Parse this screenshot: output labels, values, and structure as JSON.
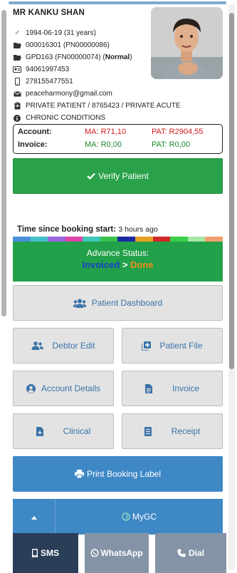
{
  "patient": {
    "name": "MR KANKU SHAN",
    "dob": "1994-06-19 (31 years)",
    "file_number": "000016301 (PN00000086)",
    "gpd_prefix": "GPD163 (FN00000074) (",
    "gpd_status": "Normal",
    "gpd_suffix": ")",
    "id_number": "94061997453",
    "phone": "278155477551",
    "email": "peaceharmony@gmail.com",
    "medical_aid": "PRIVATE PATIENT / 8765423 / PRIVATE ACUTE",
    "chronic": "CHRONIC CONDITIONS"
  },
  "finances": {
    "account_label": "Account:",
    "account_ma": "MA: R71,10",
    "account_pat": "PAT: R2904,55",
    "invoice_label": "Invoice:",
    "invoice_ma": "MA: R0,00",
    "invoice_pat": "PAT: R0,00"
  },
  "verify_label": "Verify Patient",
  "booking_time": {
    "label": "Time since booking start:",
    "value": "3 hours ago",
    "progress_colors": [
      "#4a8fd8",
      "#44c0c8",
      "#9966dd",
      "#dd44aa",
      "#3ec7b8",
      "#36c14a",
      "#1a2aa0",
      "#e6a020",
      "#d02a2a",
      "#3ad04a",
      "#a6e6a6",
      "#f0a070"
    ]
  },
  "advance_status": {
    "title": "Advance Status:",
    "from": "Invoiced",
    "arrow": ">",
    "to": "Done"
  },
  "buttons": {
    "dashboard": "Patient Dashboard",
    "debtor_edit": "Debtor Edit",
    "patient_file": "Patient File",
    "account_details": "Account Details",
    "invoice": "Invoice",
    "clinical": "Clinical",
    "receipt": "Receipt",
    "print_label": "Print Booking Label",
    "mygc": "MyGC"
  },
  "bottom": {
    "sms": "SMS",
    "whatsapp": "WhatsApp",
    "dial": "Dial"
  },
  "colors": {
    "green": "#2aa24a",
    "blue": "#3f88c6",
    "link_blue": "#3a73a8",
    "dark_nav": "#2a3e57",
    "grey_nav": "#8494a6"
  }
}
